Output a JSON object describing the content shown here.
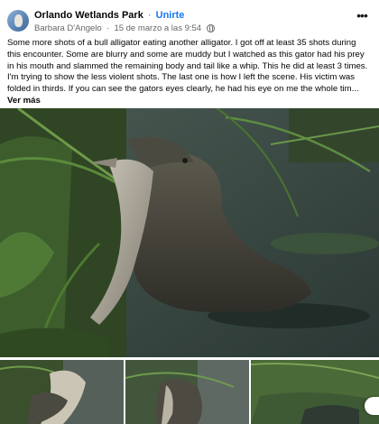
{
  "post": {
    "group_name": "Orlando Wetlands Park",
    "separator": "·",
    "join_label": "Unirte",
    "author": "Barbara D'Angelo",
    "date": "15 de marzo a las 9:54",
    "more_glyph": "•••",
    "text": "Some more shots of a bull alligator eating another alligator.  I got off at least 35 shots during this encounter.  Some are blurry and some are muddy but I watched as this gator had his prey in his mouth and slammed the remaining body and tail like a whip.  This he did at least 3 times.  I'm trying to show the less violent shots.  The last one is how I left the scene.  His victim was folded in thirds.  If you can see the gators eyes clearly, he had his eye on me the whole tim...",
    "see_more_label": "Ver más"
  },
  "icons": {
    "avatar": "group-avatar",
    "privacy": "globe-icon",
    "more": "more-options-icon"
  },
  "colors": {
    "link_blue": "#1877f2",
    "meta_gray": "#65676b",
    "text": "#050505"
  }
}
